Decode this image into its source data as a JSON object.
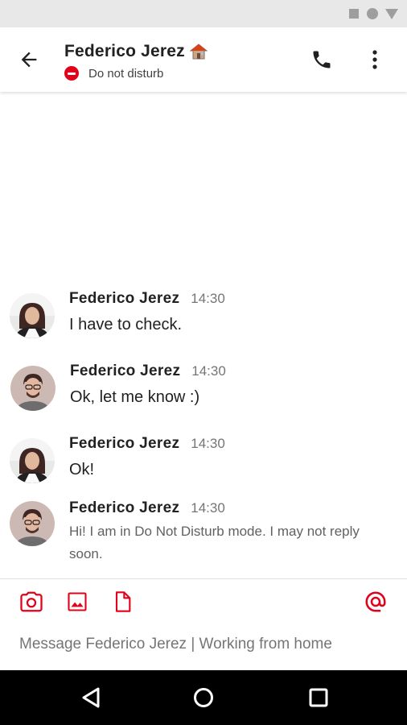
{
  "header": {
    "contact_name": "Federico Jerez",
    "presence_status": "Do not disturb",
    "back_icon": "arrow-left-icon",
    "call_icon": "phone-icon",
    "more_icon": "more-vert-icon",
    "status_emoji_icon": "house-emoji-icon"
  },
  "messages": [
    {
      "author": "Federico Jerez",
      "time": "14:30",
      "text": "I have to check.",
      "avatar": "woman-avatar"
    },
    {
      "author": "Federico Jerez",
      "time": "14:30",
      "text": "Ok, let me know :)",
      "avatar": "man-avatar"
    },
    {
      "author": "Federico Jerez",
      "time": "14:30",
      "text": "Ok!",
      "avatar": "woman-avatar"
    },
    {
      "author": "Federico Jerez",
      "time": "14:30",
      "text": "Hi! I am in Do Not Disturb mode. I may not reply soon.",
      "avatar": "man-avatar"
    }
  ],
  "composer": {
    "placeholder": "Message Federico Jerez | Working from home",
    "tools": [
      "camera-icon",
      "image-icon",
      "file-icon",
      "mention-icon"
    ]
  },
  "colors": {
    "accent": "#e2001a",
    "dnd": "#e2001a",
    "text_primary": "#212121",
    "text_secondary": "#757575"
  }
}
